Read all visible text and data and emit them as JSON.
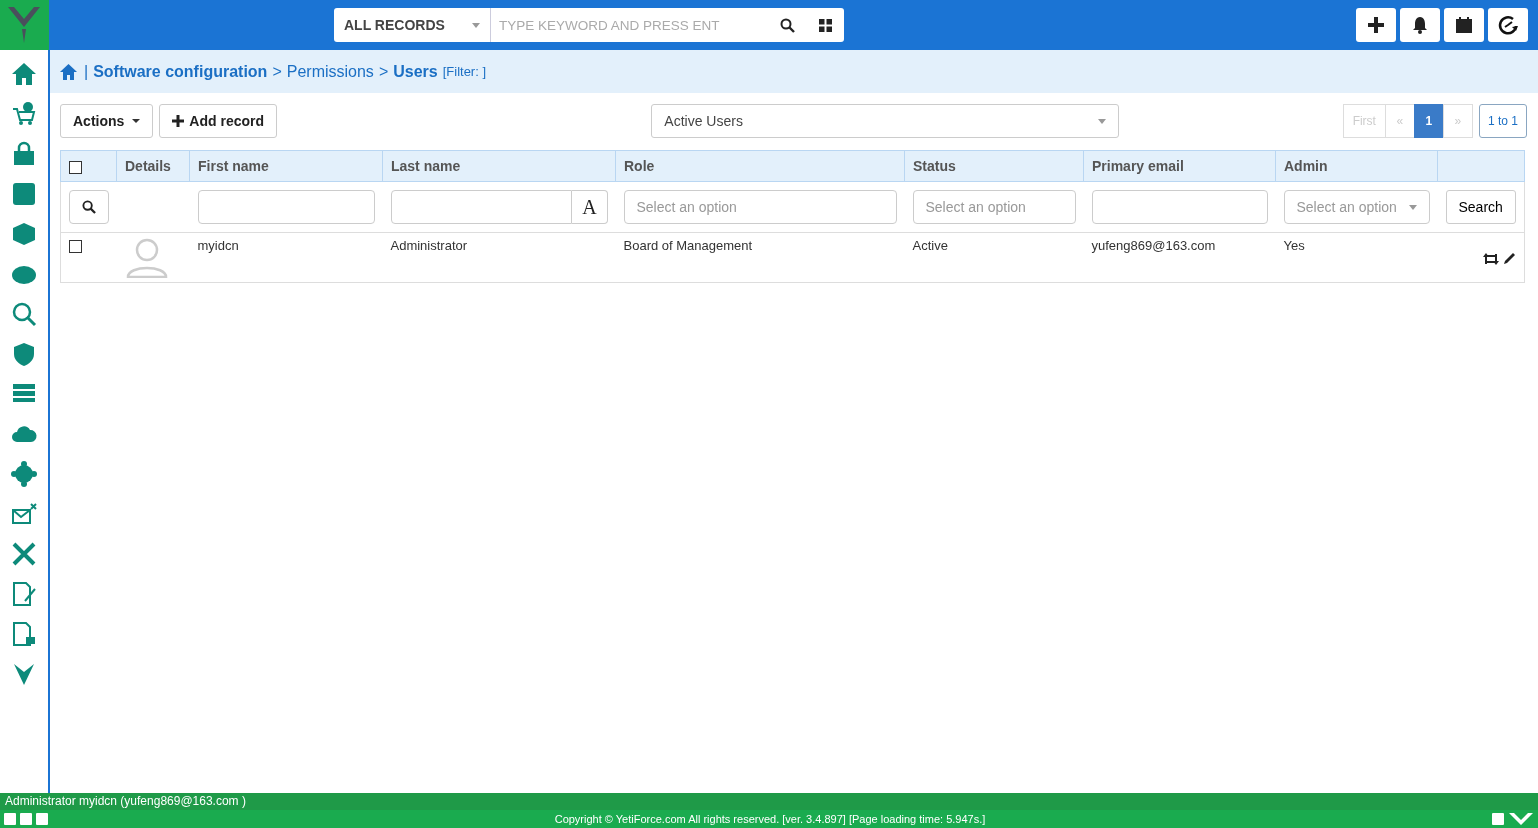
{
  "search": {
    "module": "ALL RECORDS",
    "placeholder": "TYPE KEYWORD AND PRESS ENT"
  },
  "breadcrumb": {
    "divider": "|",
    "arrow_1": ">",
    "arrow_2": ">",
    "module": "Software configuration",
    "section": "Permissions",
    "current": "Users",
    "filter": "[Filter: ]"
  },
  "toolbar": {
    "actions": "Actions",
    "add": "Add record",
    "view": "Active Users",
    "count": "1 to 1",
    "pages": [
      {
        "label": "First",
        "selected": false,
        "disabled": true
      },
      {
        "label": "«",
        "selected": false,
        "disabled": true
      },
      {
        "label": "1",
        "selected": true,
        "disabled": false
      },
      {
        "label": "»",
        "selected": false,
        "disabled": true
      }
    ]
  },
  "table": {
    "header_checked": false,
    "columns": [
      "Details",
      "First name",
      "Last name",
      "Role",
      "Status",
      "Primary email",
      "Admin"
    ],
    "filters": [
      {
        "kind": "none"
      },
      {
        "kind": "text"
      },
      {
        "kind": "text-case",
        "button": "A"
      },
      {
        "kind": "select",
        "placeholder": "Select an option"
      },
      {
        "kind": "select",
        "placeholder": "Select an option"
      },
      {
        "kind": "text"
      },
      {
        "kind": "dropdown",
        "placeholder": "Select an option"
      }
    ],
    "search_button": "Search",
    "rows": [
      {
        "checked": false,
        "cells": [
          "",
          "myidcn",
          "Administrator",
          "Board of Management",
          "Active",
          "yufeng869@163.com",
          "Yes"
        ]
      }
    ]
  },
  "footer": {
    "user": "Administrator myidcn (yufeng869@163.com )",
    "copyright": "Copyright © YetiForce.com All rights reserved. [ver. 3.4.897] [Page loading time: 5.947s.]"
  }
}
